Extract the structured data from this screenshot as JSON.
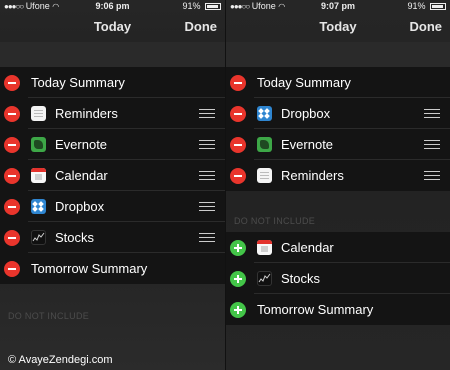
{
  "left": {
    "status": {
      "carrier": "Ufone",
      "time": "9:06 pm",
      "battery": "91%",
      "battery_level": 0.91
    },
    "nav": {
      "title": "Today",
      "done": "Done"
    },
    "included": [
      {
        "label": "Today Summary",
        "icon": null,
        "handle": false
      },
      {
        "label": "Reminders",
        "icon": "reminders-icon",
        "handle": true
      },
      {
        "label": "Evernote",
        "icon": "evernote-icon",
        "handle": true
      },
      {
        "label": "Calendar",
        "icon": "calendar-icon",
        "handle": true
      },
      {
        "label": "Dropbox",
        "icon": "dropbox-icon",
        "handle": true
      },
      {
        "label": "Stocks",
        "icon": "stocks-icon",
        "handle": true
      },
      {
        "label": "Tomorrow Summary",
        "icon": null,
        "handle": false
      }
    ],
    "do_not_include_title": "DO NOT INCLUDE"
  },
  "right": {
    "status": {
      "carrier": "Ufone",
      "time": "9:07 pm",
      "battery": "91%",
      "battery_level": 0.91
    },
    "nav": {
      "title": "Today",
      "done": "Done"
    },
    "included": [
      {
        "label": "Today Summary",
        "icon": null,
        "handle": false
      },
      {
        "label": "Dropbox",
        "icon": "dropbox-icon",
        "handle": true
      },
      {
        "label": "Evernote",
        "icon": "evernote-icon",
        "handle": true
      },
      {
        "label": "Reminders",
        "icon": "reminders-icon",
        "handle": true
      }
    ],
    "do_not_include_title": "DO NOT INCLUDE",
    "excluded": [
      {
        "label": "Calendar",
        "icon": "calendar-icon"
      },
      {
        "label": "Stocks",
        "icon": "stocks-icon"
      },
      {
        "label": "Tomorrow Summary",
        "icon": null
      }
    ]
  },
  "watermark": "© AvayeZendegi.com",
  "colors": {
    "remove": "#e9352c",
    "add": "#43c548",
    "dropbox": "#2f86d1",
    "evernote": "#3da747",
    "calendar_red": "#e3322c"
  }
}
